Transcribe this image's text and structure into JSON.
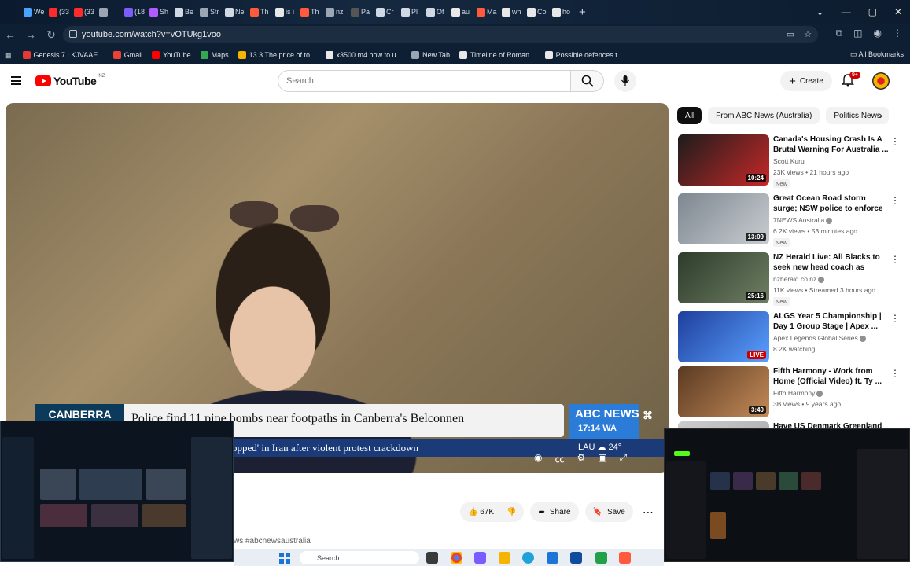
{
  "browser": {
    "tabs": [
      {
        "label": "We",
        "color": "#4aa3ff"
      },
      {
        "label": "(33",
        "color": "#ff2a2a"
      },
      {
        "label": "(33",
        "color": "#ff2a2a"
      },
      {
        "label": "",
        "color": "#9aa6b4"
      },
      {
        "label": "(18",
        "color": "#7b5cff"
      },
      {
        "label": "Sh",
        "color": "#b05cff"
      },
      {
        "label": "Be",
        "color": "#cfd8e3"
      },
      {
        "label": "Str",
        "color": "#9aa6b4"
      },
      {
        "label": "Ne",
        "color": "#cfd8e3"
      },
      {
        "label": "Th",
        "color": "#ff5a3c"
      },
      {
        "label": "is i",
        "color": "#e8e8e8"
      },
      {
        "label": "Th",
        "color": "#ff5a3c"
      },
      {
        "label": "nz",
        "color": "#9aa6b4"
      },
      {
        "label": "Pa",
        "color": "#555"
      },
      {
        "label": "Cr",
        "color": "#cfd8e3"
      },
      {
        "label": "Pl",
        "color": "#cfd8e3"
      },
      {
        "label": "Of",
        "color": "#cfd8e3"
      },
      {
        "label": "au",
        "color": "#e8e8e8"
      },
      {
        "label": "Ma",
        "color": "#ff5a3c"
      },
      {
        "label": "wh",
        "color": "#e8e8e8"
      },
      {
        "label": "Co",
        "color": "#e8e8e8"
      },
      {
        "label": "ho",
        "color": "#e8e8e8"
      }
    ],
    "new_tab": "+",
    "url": "youtube.com/watch?v=vOTUkg1voo",
    "bookmarks": [
      {
        "label": "Genesis 7 | KJVAAE...",
        "color": "#e53935"
      },
      {
        "label": "Gmail",
        "color": "#ea4335"
      },
      {
        "label": "YouTube",
        "color": "#ff0000"
      },
      {
        "label": "Maps",
        "color": "#34a853"
      },
      {
        "label": "13.3 The price of to...",
        "color": "#f4b400"
      },
      {
        "label": "x3500 m4 how to u...",
        "color": "#e8e8e8"
      },
      {
        "label": "New Tab",
        "color": "#9aa6b4"
      },
      {
        "label": "Timeline of Roman...",
        "color": "#e8e8e8"
      },
      {
        "label": "Possible defences t...",
        "color": "#e8e8e8"
      }
    ],
    "all_bookmarks": "All Bookmarks"
  },
  "youtube": {
    "logo_text": "YouTube",
    "country": "NZ",
    "search_placeholder": "Search",
    "create_label": "Create",
    "notif_count": "9+"
  },
  "player": {
    "location": "CANBERRA",
    "headline": "Police find 11 pipe bombs near footpaths in Canberra's Belconnen",
    "ticker": "opped' in Iran after violent protest crackdown",
    "abc_logo": "ABC NEWS",
    "abc_time": "17:14",
    "abc_tz": "WA",
    "weather_loc": "LAU",
    "weather_temp": "24°"
  },
  "actions": {
    "likes": "67K",
    "share": "Share",
    "save": "Save",
    "hashtags": "ws #abcnewsaustralia"
  },
  "chips": [
    "All",
    "From ABC News (Australia)",
    "Politics News"
  ],
  "videos": [
    {
      "title": "Canada's Housing Crash Is A Brutal Warning For Australia ...",
      "channel": "Scott Kuru",
      "verified": false,
      "meta": "23K views • 21 hours ago",
      "new": "New",
      "duration": "10:24",
      "live": false,
      "thumb": [
        "#1c1c1c",
        "#c62828"
      ]
    },
    {
      "title": "Great Ocean Road storm surge; NSW police to enforce protest ...",
      "channel": "7NEWS Australia",
      "verified": true,
      "meta": "6.2K views • 53 minutes ago",
      "new": "New",
      "duration": "13:09",
      "live": false,
      "thumb": [
        "#7d8790",
        "#c9cdd1"
      ]
    },
    {
      "title": "NZ Herald Live: All Blacks to seek new head coach as Scott...",
      "channel": "nzherald.co.nz",
      "verified": true,
      "meta": "11K views • Streamed 3 hours ago",
      "new": "New",
      "duration": "25:16",
      "live": false,
      "thumb": [
        "#2d3b2b",
        "#6f7f63"
      ]
    },
    {
      "title": "ALGS Year 5 Championship | Day 1 Group Stage | Apex ...",
      "channel": "Apex Legends Global Series",
      "verified": true,
      "meta": "8.2K watching",
      "new": "",
      "duration": "LIVE",
      "live": true,
      "thumb": [
        "#1f3f9c",
        "#5aa0ff"
      ]
    },
    {
      "title": "Fifth Harmony - Work from Home (Official Video) ft. Ty ...",
      "channel": "Fifth Harmony",
      "verified": true,
      "meta": "3B views • 9 years ago",
      "new": "",
      "duration": "3:40",
      "live": false,
      "thumb": [
        "#5a3a22",
        "#c48b58"
      ]
    },
    {
      "title": "Have US Denmark Greenland",
      "channel": "",
      "verified": false,
      "meta": "",
      "new": "",
      "duration": "",
      "live": false,
      "thumb": [
        "#ccc",
        "#aaa"
      ]
    }
  ],
  "taskbar": {
    "search": "Search"
  }
}
